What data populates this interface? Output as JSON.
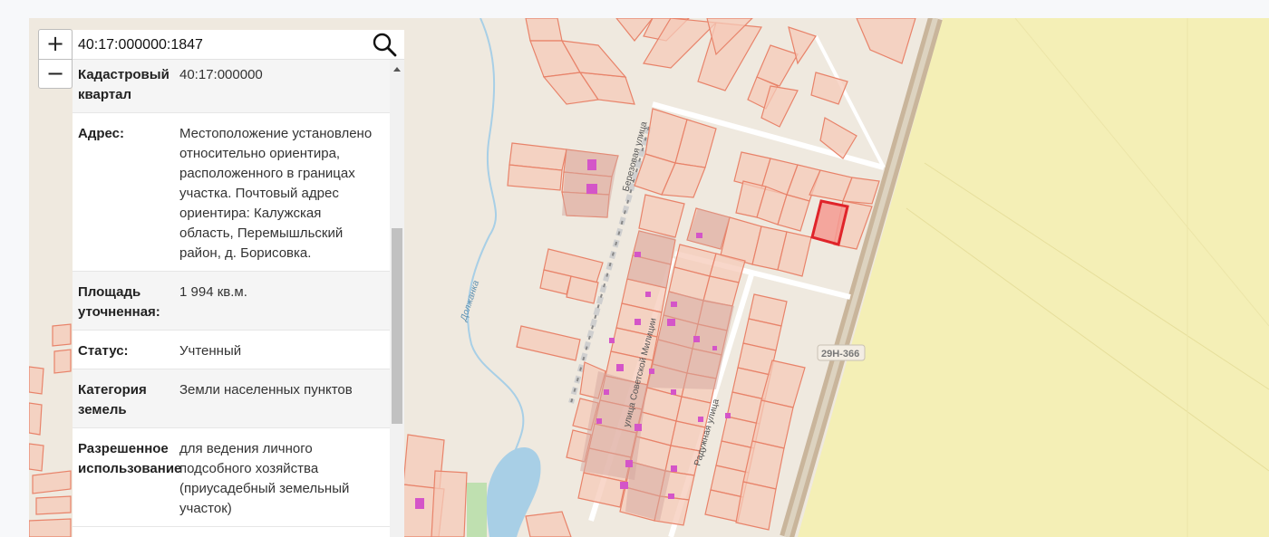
{
  "map": {
    "zoom_in": "+",
    "zoom_out": "−",
    "street_labels": {
      "berezovaya": "Березовая улица",
      "sovetskoy_militsii": "улица Советской Милиции",
      "raduzhnaya": "Радужная улица",
      "dolzhanka": "Должанка",
      "road": "29Н-366"
    },
    "colors": {
      "parcel_stroke": "#e8836a",
      "parcel_fill": "#f6c9b8",
      "selected": "#e0242a",
      "water": "#a8cfe6",
      "field": "#f4efb6"
    }
  },
  "search": {
    "value": "40:17:000000:1847",
    "icon": "search-icon"
  },
  "info": {
    "rows": [
      {
        "key": "Кадастровый квартал",
        "value": "40:17:000000"
      },
      {
        "key": "Адрес:",
        "value": "Местоположение установлено относительно ориентира, расположенного в границах участка. Почтовый адрес ориентира: Калужская область, Перемышльский район, д. Борисовка."
      },
      {
        "key": "Площадь уточненная:",
        "value": "1 994 кв.м."
      },
      {
        "key": "Статус:",
        "value": "Учтенный"
      },
      {
        "key": "Категория земель",
        "value": "Земли населенных пунктов"
      },
      {
        "key": "Разрешенное использование",
        "value": "для ведения личного подсобного хозяйства (приусадебный земельный участок)"
      }
    ]
  }
}
